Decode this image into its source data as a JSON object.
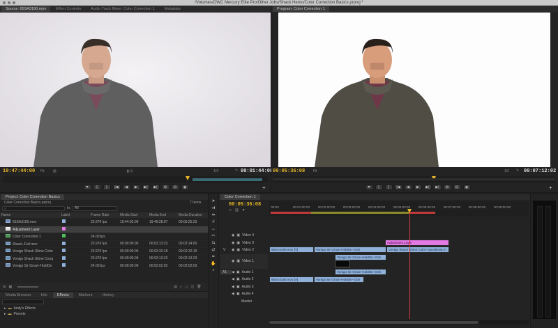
{
  "window": {
    "title": "/Volumes/OWC Mercury Elite Pro/Other Jobs/Shack Hemo/Color Correction Basics.prproj *"
  },
  "source_panel": {
    "tabs": [
      "Source: 65SA3190.mov",
      "Effect Controls",
      "Audio Track Mixer: Color Correction 1",
      "Metadata"
    ],
    "timecode_left": "19:47:44:00",
    "zoom": "Fit",
    "resolution": "1/4",
    "timecode_right": "00:01:44:08"
  },
  "program_panel": {
    "tabs": [
      "Program: Color Correction 1"
    ],
    "timecode_left": "00:05:36:08",
    "zoom": "Fit",
    "resolution": "1/2",
    "timecode_right": "00:07:12:02"
  },
  "transport_icons": [
    "marker-icon",
    "in-point-icon",
    "out-point-icon",
    "go-to-in-icon",
    "step-back-icon",
    "play-icon",
    "step-forward-icon",
    "go-to-out-icon",
    "insert-icon",
    "overwrite-icon",
    "export-frame-icon"
  ],
  "project_panel": {
    "tabs": [
      "Project: Color Correction Basics"
    ],
    "file": "Color Correction Basics.prproj",
    "item_count": "7 Items",
    "filter": "All",
    "columns": [
      "Name",
      "Label",
      "Frame Rate",
      "Media Start",
      "Media End",
      "Media Duration"
    ],
    "rows": [
      {
        "name": "65SA3190.mov",
        "label_color": "#8fb1d9",
        "frame_rate": "23.976 fps",
        "media_start": "19:44:02:09",
        "media_end": "19:49:28:07",
        "duration": "00:05:25:23",
        "selected": false
      },
      {
        "name": "Adjustment Layer",
        "label_color": "#e37ae3",
        "frame_rate": "",
        "media_start": "",
        "media_end": "",
        "duration": "",
        "selected": true
      },
      {
        "name": "Color Correction 1",
        "label_color": "#4fbf5a",
        "frame_rate": "24.00 fps",
        "media_start": "",
        "media_end": "",
        "duration": "",
        "selected": false
      },
      {
        "name": "Shack–Full.mov",
        "label_color": "#8fb1d9",
        "frame_rate": "23.976 fps",
        "media_start": "00:00:00:00",
        "media_end": "00:02:13:23",
        "duration": "00:02:14:00",
        "selected": false
      },
      {
        "name": "Vonigo Shack Shine Color",
        "label_color": "#8fb1d9",
        "frame_rate": "23.976 fps",
        "media_start": "00:00:00:00",
        "media_end": "00:02:32:18",
        "duration": "00:02:32:19",
        "selected": false
      },
      {
        "name": "Vonigo Shack Shine Conq",
        "label_color": "#8fb1d9",
        "frame_rate": "23.976 fps",
        "media_start": "00:00:00:00",
        "media_end": "00:02:13:23",
        "duration": "00:02:13:23",
        "selected": false
      },
      {
        "name": "Vonigo Sir Grout–HoldOn",
        "label_color": "#8fb1d9",
        "frame_rate": "24.00 fps",
        "media_start": "00:00:00:00",
        "media_end": "00:02:02:02",
        "duration": "00:02:02:03",
        "selected": false
      }
    ]
  },
  "effects_panel": {
    "tabs": [
      "Media Browser",
      "Info",
      "Effects",
      "Markers",
      "History"
    ],
    "items": [
      "Andy's Effects",
      "Presets"
    ]
  },
  "timeline": {
    "tabs": [
      "Color Correction 1"
    ],
    "timecode": "00:05:36:08",
    "ruler": [
      "00:00",
      "00:01:00:00",
      "00:02:00:00",
      "00:03:00:00",
      "00:04:00:00",
      "00:05:00:00",
      "00:06:00:00",
      "00:07:00:00",
      "00:08:00:00",
      "00:09:00:00"
    ],
    "tracks": [
      {
        "name": "Video 4",
        "tag": ""
      },
      {
        "name": "Video 3",
        "tag": ""
      },
      {
        "name": "Video 2",
        "tag": "V"
      },
      {
        "name": "Video 1",
        "tag": ""
      },
      {
        "name": "Audio 1",
        "tag": "A1"
      },
      {
        "name": "Audio 2",
        "tag": ""
      },
      {
        "name": "Audio 3",
        "tag": ""
      },
      {
        "name": "Audio 4",
        "tag": ""
      },
      {
        "name": "Master",
        "tag": ""
      }
    ],
    "clips": {
      "adj": "Adjustment Layer",
      "v2a": "65SA3190.mov [V]",
      "v2b": "Vonigo Sir Grout–HoldOn–Ooh",
      "v2c": "Vonigo Shack Shine Color–OpenBook.m",
      "v1a": "Vonigo Sir Grout–HoldOn–Ooh",
      "a1a": "Vonigo Sir Grout–HoldOn–Ooh",
      "a2a": "65SA3190.mov [A]",
      "a2b": "Vonigo Sir Grout–HoldOn–Ooh"
    }
  },
  "tools": [
    "selection-icon",
    "track-select-icon",
    "ripple-edit-icon",
    "rolling-edit-icon",
    "rate-stretch-icon",
    "razor-icon",
    "slip-icon",
    "slide-icon",
    "pen-icon",
    "hand-icon",
    "zoom-icon"
  ]
}
